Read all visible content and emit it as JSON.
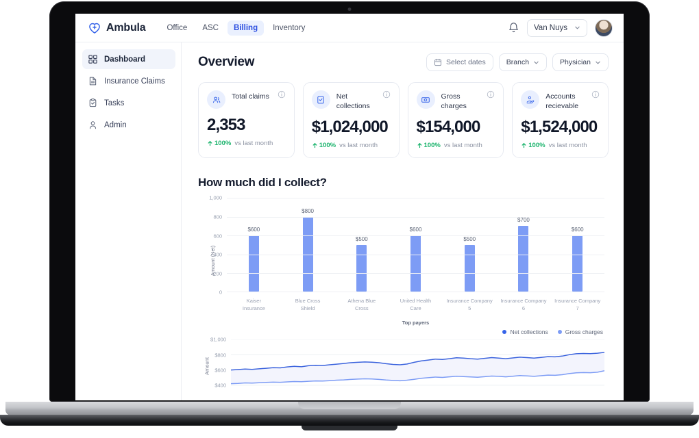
{
  "device": {
    "model_label": "MacBook Pro"
  },
  "topbar": {
    "brand": "Ambula",
    "tabs": [
      {
        "label": "Office",
        "active": false
      },
      {
        "label": "ASC",
        "active": false
      },
      {
        "label": "Billing",
        "active": true
      },
      {
        "label": "Inventory",
        "active": false
      }
    ],
    "branch_value": "Van Nuys"
  },
  "sidebar": {
    "items": [
      {
        "label": "Dashboard",
        "icon": "grid-icon",
        "active": true
      },
      {
        "label": "Insurance Claims",
        "icon": "document-icon",
        "active": false
      },
      {
        "label": "Tasks",
        "icon": "clipboard-check-icon",
        "active": false
      },
      {
        "label": "Admin",
        "icon": "user-icon",
        "active": false
      }
    ]
  },
  "main": {
    "title": "Overview",
    "filters": [
      {
        "label": "Select dates",
        "icon": "calendar-icon",
        "chevron": false
      },
      {
        "label": "Branch",
        "icon": null,
        "chevron": true
      },
      {
        "label": "Physician",
        "icon": null,
        "chevron": true
      }
    ],
    "cards": [
      {
        "label": "Total claims",
        "value": "2,353",
        "delta": "100%",
        "note": "vs last month",
        "icon": "users-icon"
      },
      {
        "label": "Net collections",
        "value": "$1,024,000",
        "delta": "100%",
        "note": "vs last month",
        "icon": "check-square-icon"
      },
      {
        "label": "Gross charges",
        "value": "$154,000",
        "delta": "100%",
        "note": "vs last month",
        "icon": "money-icon"
      },
      {
        "label": "Accounts recievable",
        "value": "$1,524,000",
        "delta": "100%",
        "note": "vs last month",
        "icon": "hand-money-icon"
      }
    ],
    "section_title": "How much did I collect?",
    "colors": {
      "accent": "#3563e9",
      "bar": "#7d9cf5",
      "positive": "#17b26a",
      "line_gross": "#3b63dd",
      "line_net": "#7d9cf5"
    }
  },
  "chart_data": [
    {
      "type": "bar",
      "title": "How much did I collect?",
      "categories": [
        "Kaiser Insurance",
        "Blue Cross Shield",
        "Athena Blue Cross",
        "United Health Care",
        "Insurance Company 5",
        "Insurance Company 6",
        "Insurance Company 7"
      ],
      "values": [
        600,
        800,
        500,
        600,
        500,
        700,
        600
      ],
      "value_labels": [
        "$600",
        "$800",
        "$500",
        "$600",
        "$500",
        "$700",
        "$600"
      ],
      "xlabel": "Top payers",
      "ylabel": "Amount (Net)",
      "ylim": [
        0,
        1000
      ],
      "yticks": [
        1000,
        800,
        600,
        400,
        200,
        0
      ],
      "ytick_labels": [
        "1,000",
        "800",
        "600",
        "400",
        "200",
        "0"
      ],
      "grid": true,
      "legend": false
    },
    {
      "type": "area",
      "title": "",
      "xlabel": "",
      "ylabel": "Amount",
      "ylim": [
        300,
        1000
      ],
      "yticks": [
        1000,
        800,
        600,
        400
      ],
      "ytick_labels": [
        "$1,000",
        "$800",
        "$600",
        "$400"
      ],
      "grid": true,
      "legend_position": "top-right",
      "series": [
        {
          "name": "Gross charges",
          "values": [
            600,
            605,
            612,
            608,
            615,
            622,
            630,
            628,
            640,
            648,
            642,
            655,
            660,
            658,
            668,
            676,
            685,
            695,
            700,
            705,
            702,
            695,
            682,
            672,
            668,
            678,
            700,
            718,
            730,
            742,
            738,
            748,
            760,
            756,
            748,
            742,
            752,
            762,
            756,
            748,
            758,
            768,
            762,
            755,
            765,
            775,
            772,
            782,
            800,
            812,
            816,
            814,
            820,
            830
          ]
        },
        {
          "name": "Net collections",
          "values": [
            420,
            424,
            430,
            428,
            432,
            436,
            440,
            438,
            444,
            448,
            446,
            452,
            456,
            454,
            460,
            466,
            470,
            476,
            480,
            484,
            482,
            476,
            468,
            462,
            458,
            466,
            478,
            490,
            498,
            506,
            502,
            510,
            518,
            514,
            508,
            504,
            512,
            520,
            516,
            510,
            518,
            526,
            522,
            516,
            524,
            532,
            530,
            538,
            552,
            562,
            566,
            564,
            570,
            590
          ]
        }
      ]
    }
  ]
}
